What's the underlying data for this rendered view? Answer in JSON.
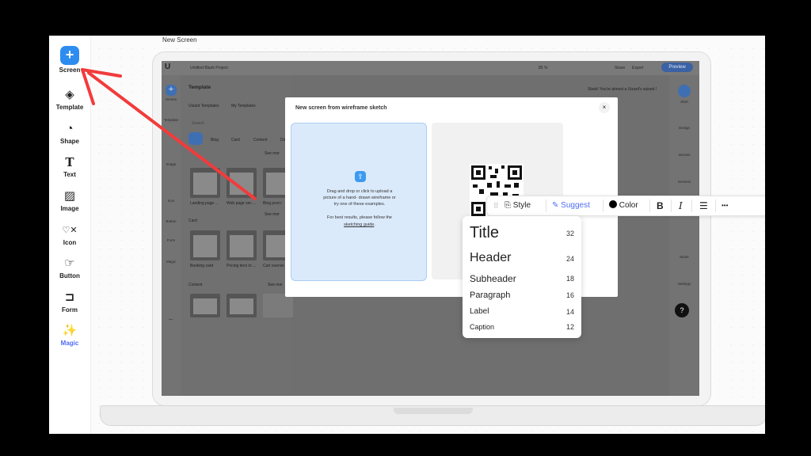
{
  "new_screen_label": "New Screen",
  "toolbar": {
    "items": [
      {
        "label": "Screen",
        "icon": "plus-icon"
      },
      {
        "label": "Template",
        "icon": "layers-icon"
      },
      {
        "label": "Shape",
        "icon": "shapes-icon"
      },
      {
        "label": "Text",
        "icon": "text-icon"
      },
      {
        "label": "Image",
        "icon": "image-icon"
      },
      {
        "label": "Icon",
        "icon": "icon-grid-icon"
      },
      {
        "label": "Button",
        "icon": "pointer-icon"
      },
      {
        "label": "Form",
        "icon": "form-icon"
      },
      {
        "label": "Magic",
        "icon": "magic-wand-icon"
      }
    ]
  },
  "inner_app": {
    "project_title": "Untitled Blank Project",
    "zoom": "85 %",
    "share": "Share",
    "export": "Export",
    "preview": "Preview",
    "banner": "Sleek! You're almost a Uizard's wizard !",
    "left_labels": [
      "Screen",
      "Template",
      "Image",
      "Icon",
      "Button",
      "Form",
      "Magic"
    ],
    "template_panel": {
      "title": "Template",
      "tabs": [
        "Uizard Templates",
        "My Templates"
      ],
      "search_placeholder": "Search",
      "filters": [
        "Blog",
        "Card",
        "Content",
        "Dir"
      ],
      "see_more": "See mor",
      "section_card": "Card",
      "section_content": "Content",
      "thumbs_row1": [
        "Landing page ...",
        "Web page sec ...",
        "Blog post r"
      ],
      "thumbs_row2": [
        "Booking card",
        "Pricing tiers to ...",
        "Cart overvie"
      ]
    },
    "right_rail": [
      "Start",
      "Design",
      "Interact",
      "Screens",
      "Mode",
      "Settings"
    ]
  },
  "modal": {
    "title": "New screen from wireframe sketch",
    "close": "×",
    "dropzone_line1": "Drag and drop or click to upload a",
    "dropzone_line2": "picture of a hand- drawn wireframe or",
    "dropzone_line3": "try one of these examples.",
    "dropzone_hint": "For best results, please follow the",
    "dropzone_link": "sketching guide",
    "dropzone_link_suffix": "."
  },
  "format_bar": {
    "style": "Style",
    "suggest": "Suggest",
    "color": "Color",
    "bold": "B",
    "italic": "I",
    "more": "•••"
  },
  "typography": [
    {
      "name": "Title",
      "size": "32"
    },
    {
      "name": "Header",
      "size": "24"
    },
    {
      "name": "Subheader",
      "size": "18"
    },
    {
      "name": "Paragraph",
      "size": "16"
    },
    {
      "name": "Label",
      "size": "14"
    },
    {
      "name": "Caption",
      "size": "12"
    }
  ],
  "colors": {
    "accent": "#2d8cf0",
    "magic": "#4f6cf5",
    "arrow": "#f23b3b"
  }
}
